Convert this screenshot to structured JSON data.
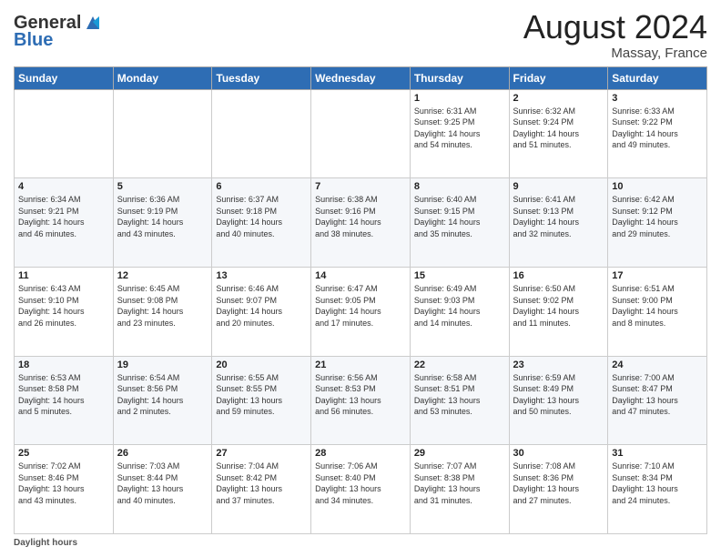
{
  "header": {
    "logo_line1": "General",
    "logo_line2": "Blue",
    "month_title": "August 2024",
    "location": "Massay, France"
  },
  "days_of_week": [
    "Sunday",
    "Monday",
    "Tuesday",
    "Wednesday",
    "Thursday",
    "Friday",
    "Saturday"
  ],
  "weeks": [
    [
      {
        "day": "",
        "info": ""
      },
      {
        "day": "",
        "info": ""
      },
      {
        "day": "",
        "info": ""
      },
      {
        "day": "",
        "info": ""
      },
      {
        "day": "1",
        "info": "Sunrise: 6:31 AM\nSunset: 9:25 PM\nDaylight: 14 hours\nand 54 minutes."
      },
      {
        "day": "2",
        "info": "Sunrise: 6:32 AM\nSunset: 9:24 PM\nDaylight: 14 hours\nand 51 minutes."
      },
      {
        "day": "3",
        "info": "Sunrise: 6:33 AM\nSunset: 9:22 PM\nDaylight: 14 hours\nand 49 minutes."
      }
    ],
    [
      {
        "day": "4",
        "info": "Sunrise: 6:34 AM\nSunset: 9:21 PM\nDaylight: 14 hours\nand 46 minutes."
      },
      {
        "day": "5",
        "info": "Sunrise: 6:36 AM\nSunset: 9:19 PM\nDaylight: 14 hours\nand 43 minutes."
      },
      {
        "day": "6",
        "info": "Sunrise: 6:37 AM\nSunset: 9:18 PM\nDaylight: 14 hours\nand 40 minutes."
      },
      {
        "day": "7",
        "info": "Sunrise: 6:38 AM\nSunset: 9:16 PM\nDaylight: 14 hours\nand 38 minutes."
      },
      {
        "day": "8",
        "info": "Sunrise: 6:40 AM\nSunset: 9:15 PM\nDaylight: 14 hours\nand 35 minutes."
      },
      {
        "day": "9",
        "info": "Sunrise: 6:41 AM\nSunset: 9:13 PM\nDaylight: 14 hours\nand 32 minutes."
      },
      {
        "day": "10",
        "info": "Sunrise: 6:42 AM\nSunset: 9:12 PM\nDaylight: 14 hours\nand 29 minutes."
      }
    ],
    [
      {
        "day": "11",
        "info": "Sunrise: 6:43 AM\nSunset: 9:10 PM\nDaylight: 14 hours\nand 26 minutes."
      },
      {
        "day": "12",
        "info": "Sunrise: 6:45 AM\nSunset: 9:08 PM\nDaylight: 14 hours\nand 23 minutes."
      },
      {
        "day": "13",
        "info": "Sunrise: 6:46 AM\nSunset: 9:07 PM\nDaylight: 14 hours\nand 20 minutes."
      },
      {
        "day": "14",
        "info": "Sunrise: 6:47 AM\nSunset: 9:05 PM\nDaylight: 14 hours\nand 17 minutes."
      },
      {
        "day": "15",
        "info": "Sunrise: 6:49 AM\nSunset: 9:03 PM\nDaylight: 14 hours\nand 14 minutes."
      },
      {
        "day": "16",
        "info": "Sunrise: 6:50 AM\nSunset: 9:02 PM\nDaylight: 14 hours\nand 11 minutes."
      },
      {
        "day": "17",
        "info": "Sunrise: 6:51 AM\nSunset: 9:00 PM\nDaylight: 14 hours\nand 8 minutes."
      }
    ],
    [
      {
        "day": "18",
        "info": "Sunrise: 6:53 AM\nSunset: 8:58 PM\nDaylight: 14 hours\nand 5 minutes."
      },
      {
        "day": "19",
        "info": "Sunrise: 6:54 AM\nSunset: 8:56 PM\nDaylight: 14 hours\nand 2 minutes."
      },
      {
        "day": "20",
        "info": "Sunrise: 6:55 AM\nSunset: 8:55 PM\nDaylight: 13 hours\nand 59 minutes."
      },
      {
        "day": "21",
        "info": "Sunrise: 6:56 AM\nSunset: 8:53 PM\nDaylight: 13 hours\nand 56 minutes."
      },
      {
        "day": "22",
        "info": "Sunrise: 6:58 AM\nSunset: 8:51 PM\nDaylight: 13 hours\nand 53 minutes."
      },
      {
        "day": "23",
        "info": "Sunrise: 6:59 AM\nSunset: 8:49 PM\nDaylight: 13 hours\nand 50 minutes."
      },
      {
        "day": "24",
        "info": "Sunrise: 7:00 AM\nSunset: 8:47 PM\nDaylight: 13 hours\nand 47 minutes."
      }
    ],
    [
      {
        "day": "25",
        "info": "Sunrise: 7:02 AM\nSunset: 8:46 PM\nDaylight: 13 hours\nand 43 minutes."
      },
      {
        "day": "26",
        "info": "Sunrise: 7:03 AM\nSunset: 8:44 PM\nDaylight: 13 hours\nand 40 minutes."
      },
      {
        "day": "27",
        "info": "Sunrise: 7:04 AM\nSunset: 8:42 PM\nDaylight: 13 hours\nand 37 minutes."
      },
      {
        "day": "28",
        "info": "Sunrise: 7:06 AM\nSunset: 8:40 PM\nDaylight: 13 hours\nand 34 minutes."
      },
      {
        "day": "29",
        "info": "Sunrise: 7:07 AM\nSunset: 8:38 PM\nDaylight: 13 hours\nand 31 minutes."
      },
      {
        "day": "30",
        "info": "Sunrise: 7:08 AM\nSunset: 8:36 PM\nDaylight: 13 hours\nand 27 minutes."
      },
      {
        "day": "31",
        "info": "Sunrise: 7:10 AM\nSunset: 8:34 PM\nDaylight: 13 hours\nand 24 minutes."
      }
    ]
  ],
  "footer": {
    "label": "Daylight hours"
  }
}
